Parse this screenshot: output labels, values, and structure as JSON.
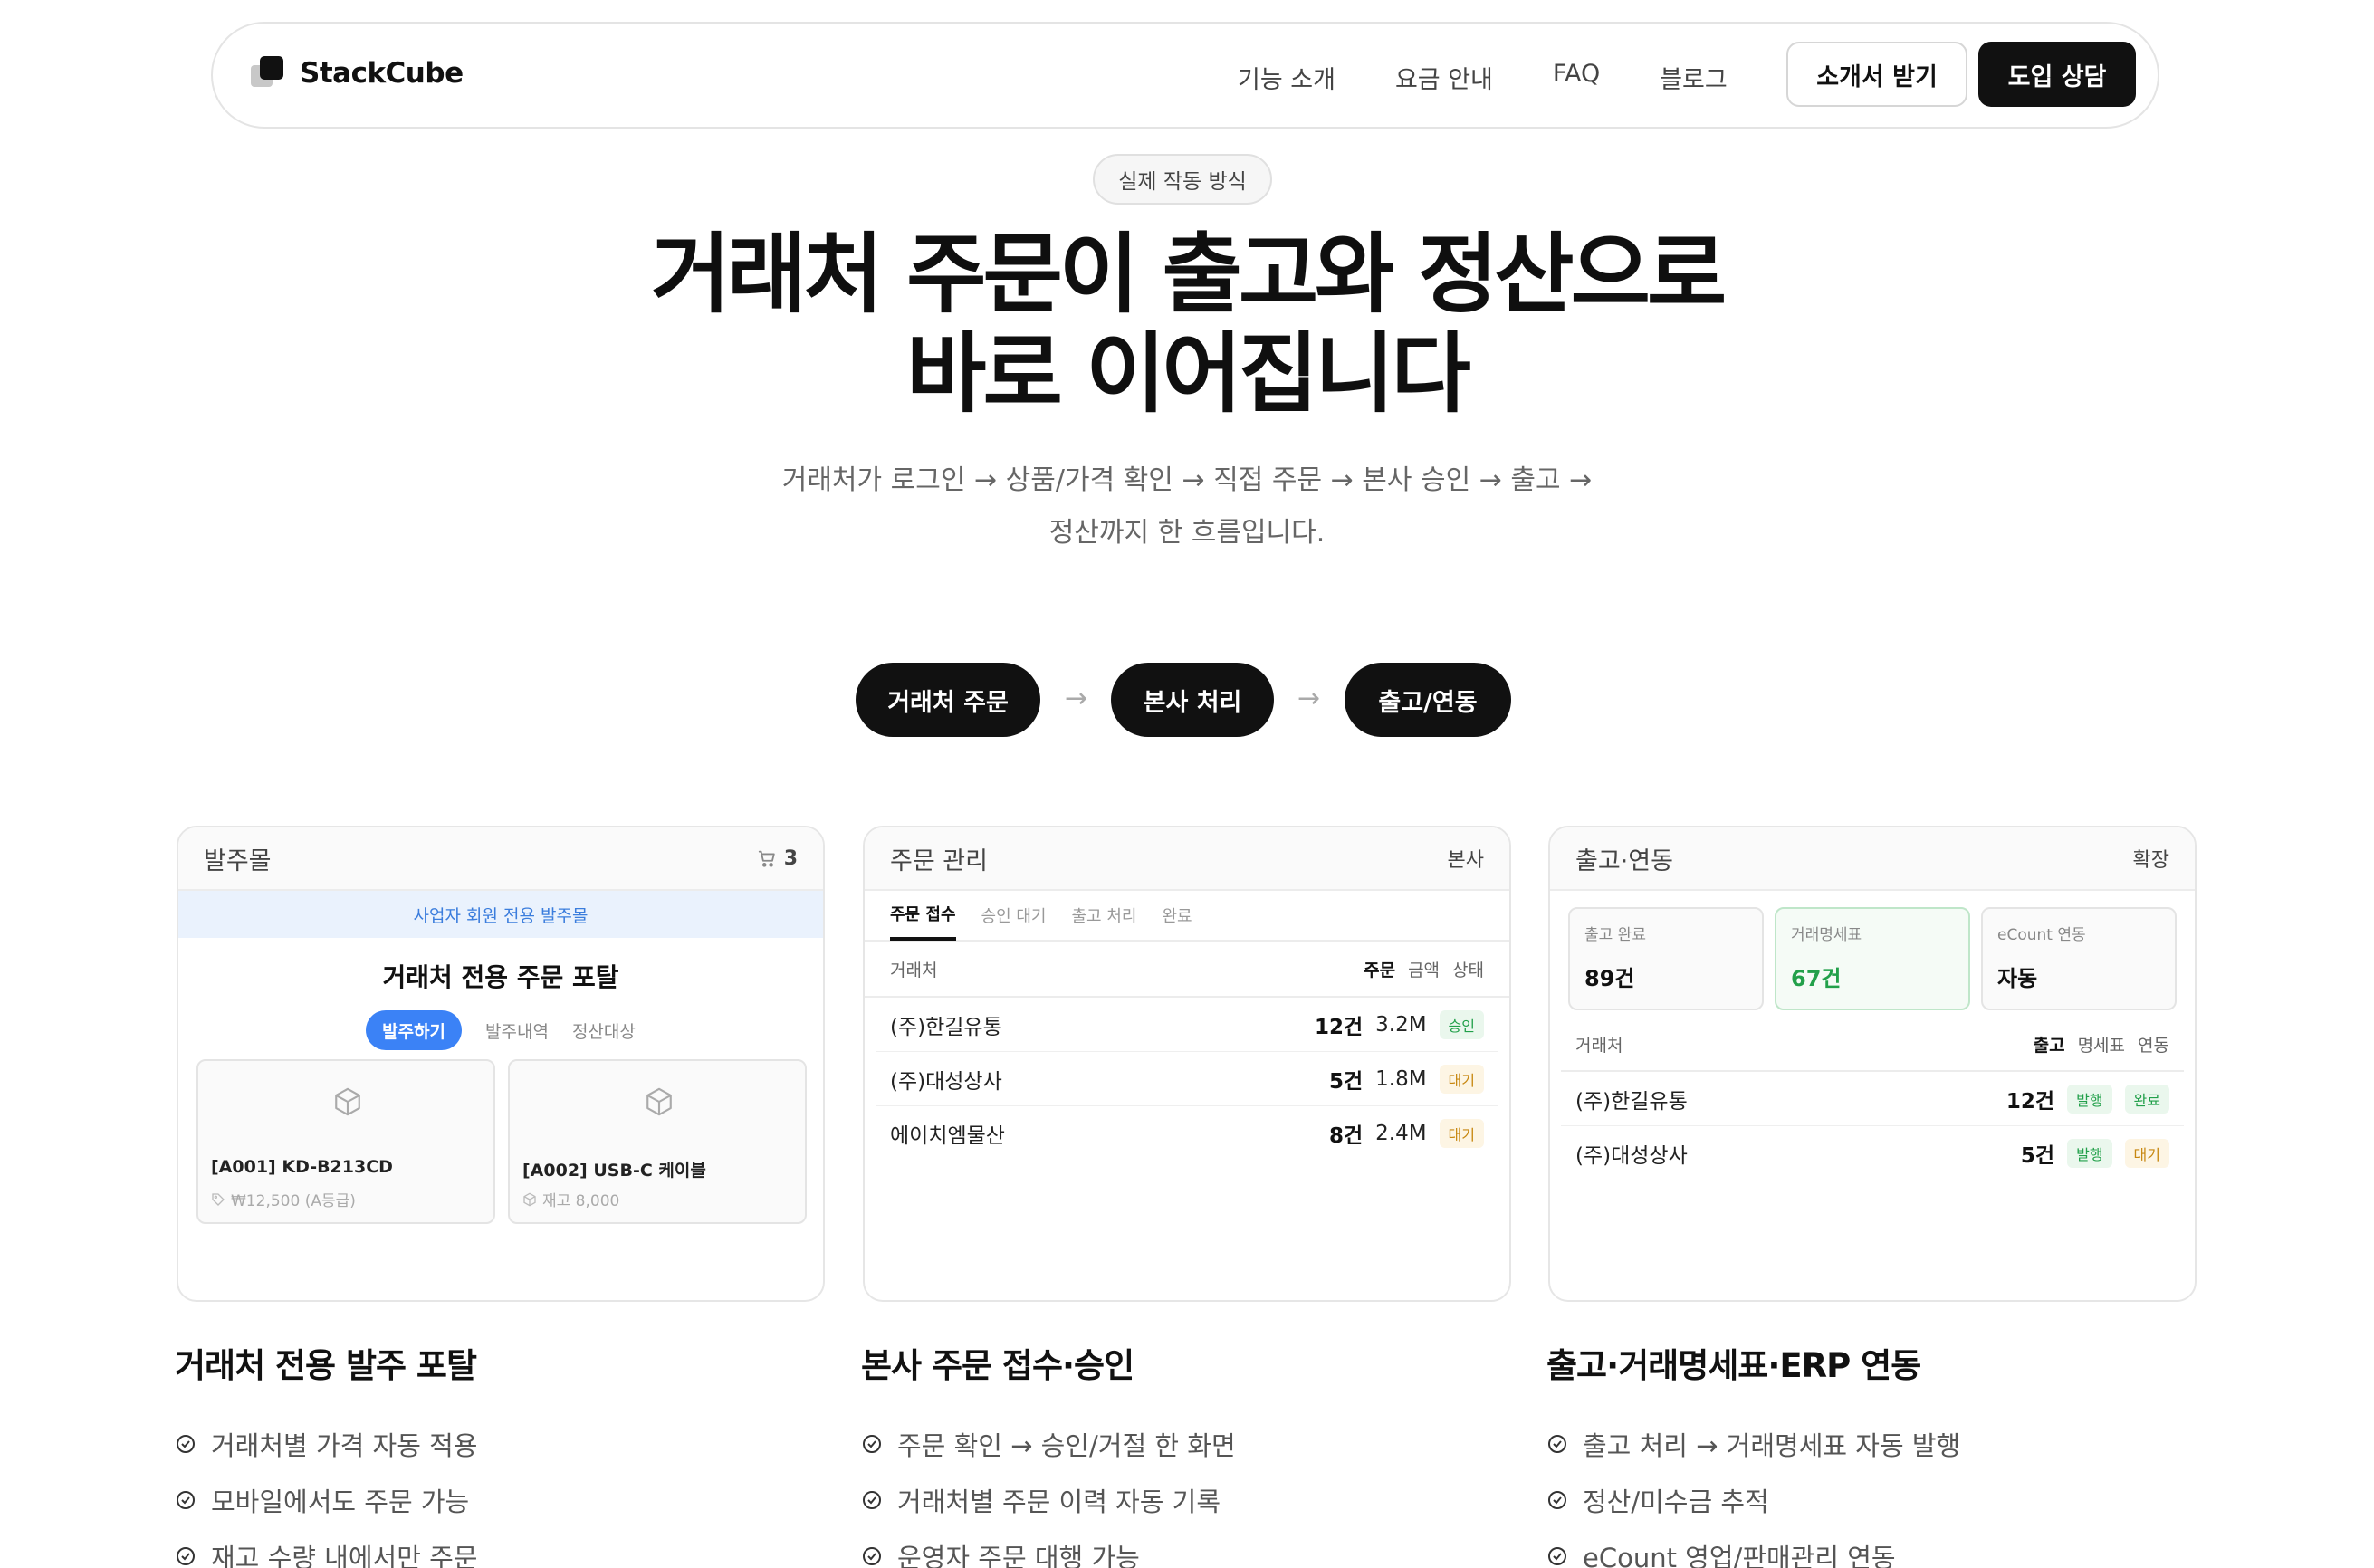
{
  "nav": {
    "logo": "StackCube",
    "links": [
      "기능 소개",
      "요금 안내",
      "FAQ",
      "블로그"
    ],
    "btn_brochure": "소개서 받기",
    "btn_consult": "도입 상담"
  },
  "hero": {
    "badge": "실제 작동 방식",
    "title_line1": "거래처 주문이 출고와 정산으로",
    "title_line2": "바로 이어집니다",
    "sub_line1": "거래처가 로그인 → 상품/가격 확인 → 직접 주문 → 본사 승인 → 출고 →",
    "sub_line2": "정산까지 한 흐름입니다."
  },
  "flow": {
    "steps": [
      "거래처 주문",
      "본사 처리",
      "출고/연동"
    ],
    "arrow": "→"
  },
  "card1": {
    "title": "발주몰",
    "cart_count": "3",
    "member_bar": "사업자 회원 전용 발주몰",
    "portal_title": "거래처 전용 주문 포탈",
    "tabs": [
      "발주하기",
      "발주내역",
      "정산대상"
    ],
    "products": [
      {
        "name": "[A001] KD-B213CD",
        "info": "₩12,500 (A등급)"
      },
      {
        "name": "[A002] USB-C 케이블",
        "info": "재고 8,000"
      }
    ]
  },
  "card2": {
    "title": "주문 관리",
    "right": "본사",
    "tabs": [
      "주문 접수",
      "승인 대기",
      "출고 처리",
      "완료"
    ],
    "headers": {
      "name": "거래처",
      "c1": "주문",
      "c2": "금액",
      "c3": "상태"
    },
    "rows": [
      {
        "name": "(주)한길유통",
        "count": "12건",
        "amount": "3.2M",
        "status": "승인"
      },
      {
        "name": "(주)대성상사",
        "count": "5건",
        "amount": "1.8M",
        "status": "대기"
      },
      {
        "name": "에이치엠물산",
        "count": "8건",
        "amount": "2.4M",
        "status": "대기"
      }
    ]
  },
  "card3": {
    "title": "출고·연동",
    "right": "확장",
    "stats": [
      {
        "label": "출고 완료",
        "value": "89건"
      },
      {
        "label": "거래명세표",
        "value": "67건"
      },
      {
        "label": "eCount 연동",
        "value": "자동"
      }
    ],
    "headers": {
      "name": "거래처",
      "c1": "출고",
      "c2": "명세표",
      "c3": "연동"
    },
    "rows": [
      {
        "name": "(주)한길유통",
        "count": "12건",
        "invoice": "발행",
        "sync": "완료"
      },
      {
        "name": "(주)대성상사",
        "count": "5건",
        "invoice": "발행",
        "sync": "대기"
      }
    ]
  },
  "features": [
    {
      "title": "거래처 전용 발주 포탈",
      "items": [
        "거래처별 가격 자동 적용",
        "모바일에서도 주문 가능",
        "재고 수량 내에서만 주문"
      ]
    },
    {
      "title": "본사 주문 접수·승인",
      "items": [
        "주문 확인 → 승인/거절 한 화면",
        "거래처별 주문 이력 자동 기록",
        "운영자 주문 대행 가능"
      ]
    },
    {
      "title": "출고·거래명세표·ERP 연동",
      "items": [
        "출고 처리 → 거래명세표 자동 발행",
        "정산/미수금 추적",
        "eCount 영업/판매관리 연동"
      ]
    }
  ],
  "colors": {
    "accent_blue": "#3b82f6",
    "success": "#22a04a",
    "warning": "#c78710",
    "dark": "#111111"
  }
}
